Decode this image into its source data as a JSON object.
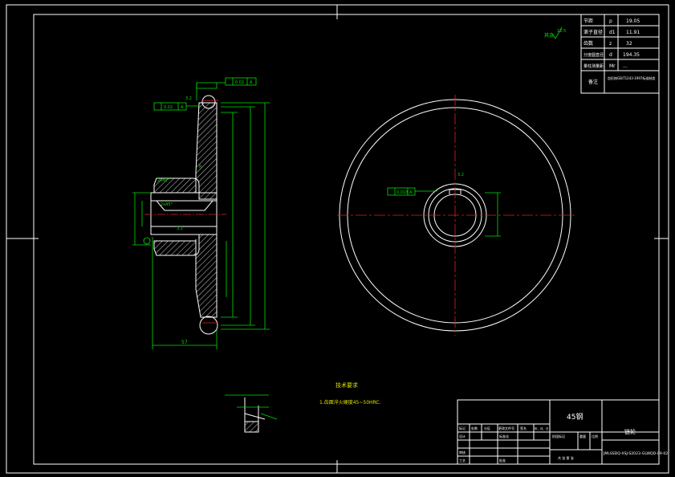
{
  "params_table": {
    "rows": [
      {
        "name": "节距",
        "sym": "p",
        "val": "19.05"
      },
      {
        "name": "滚子直径",
        "sym": "d1",
        "val": "11.91"
      },
      {
        "name": "齿数",
        "sym": "z",
        "val": "32"
      },
      {
        "name": "分度圆直径",
        "sym": "d",
        "val": "194.35"
      },
      {
        "name": "量柱测量距",
        "sym": "Mr",
        "val": "..."
      }
    ],
    "note_label": "备注",
    "note_text": "齿形按GB/T1243-1997标准制造"
  },
  "roughness_note": {
    "prefix": "其余",
    "value": "12.5"
  },
  "tech_req": {
    "title": "技术要求",
    "item": "1.齿面淬火硬度45~50HRC."
  },
  "section_view": {
    "dim_57": "57",
    "dim_32": "32",
    "rough_32": "3.2",
    "tol_flat": "0.02",
    "tol_runout": "0.02",
    "datum": "A",
    "chamfer": "2x45°",
    "fillet": "R"
  },
  "front_view": {
    "keyway_rough": "3.2",
    "keyway_tol": "0.018",
    "datum": "A"
  },
  "title_block": {
    "material": "45钢",
    "part_name": "链轮",
    "drawing_no": "JMLSSDQ-XSJ-S2023-GLWQD-09-02",
    "labels": [
      "标记",
      "处数",
      "分区",
      "更改文件号",
      "签名",
      "年、月、日",
      "设计",
      "标准化",
      "审核",
      "工艺",
      "批准",
      "阶段标记",
      "重量",
      "比例"
    ],
    "sheet": "共 张 第 张"
  }
}
